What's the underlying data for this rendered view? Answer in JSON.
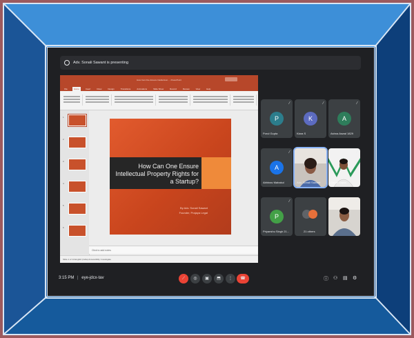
{
  "presenting_banner": "Adv. Sonali Sawant is presenting",
  "ppt": {
    "window_title": "How Can One Ensure Intellectual... - PowerPoint",
    "tabs": [
      "File",
      "Home",
      "Insert",
      "Draw",
      "Design",
      "Transitions",
      "Animations",
      "Slide Show",
      "Record",
      "Review",
      "View",
      "Help"
    ],
    "active_tab": "Home",
    "thumb_numbers": [
      "1",
      "2",
      "3",
      "4",
      "5",
      "6"
    ],
    "slide_title": "How Can One Ensure Intellectual Property Rights for a Startup?",
    "slide_by": "By Adv. Sonali Sawant",
    "slide_role": "Founder, Prajaya Legal",
    "notes_placeholder": "Click to add notes",
    "status_text": "Slide 1 of 14   English (India)   Accessibility: Investigate"
  },
  "participants": [
    {
      "name": "Porul Gupta",
      "initial": "P",
      "color": "#2c7d8c"
    },
    {
      "name": "Kiara S",
      "initial": "K",
      "color": "#5c6bc0"
    },
    {
      "name": "Ashna Aswal 1829",
      "initial": "A",
      "color": "#2e7d5b"
    },
    {
      "name": "Abhinav Mahakul",
      "initial": "A",
      "color": "#1a73e8"
    },
    {
      "name": "Adv. Sonali Sawant",
      "initial": "",
      "color": "#000000"
    },
    {
      "name": "Garvit Gupta",
      "initial": "",
      "color": "#000000"
    },
    {
      "name": "Priyanshu Singh 21...",
      "initial": "P",
      "color": "#43a047"
    },
    {
      "name": "21 others",
      "initial": "",
      "color": "#000000"
    },
    {
      "name": "",
      "initial": "",
      "color": "#000000"
    }
  ],
  "meeting": {
    "time": "3:15 PM",
    "code": "eye-jdcx-tav"
  },
  "controls": {
    "mic": "mic-off-icon",
    "camera": "camera-icon",
    "captions": "captions-icon",
    "present": "present-icon",
    "more": "more-icon",
    "hangup": "hangup-icon"
  }
}
